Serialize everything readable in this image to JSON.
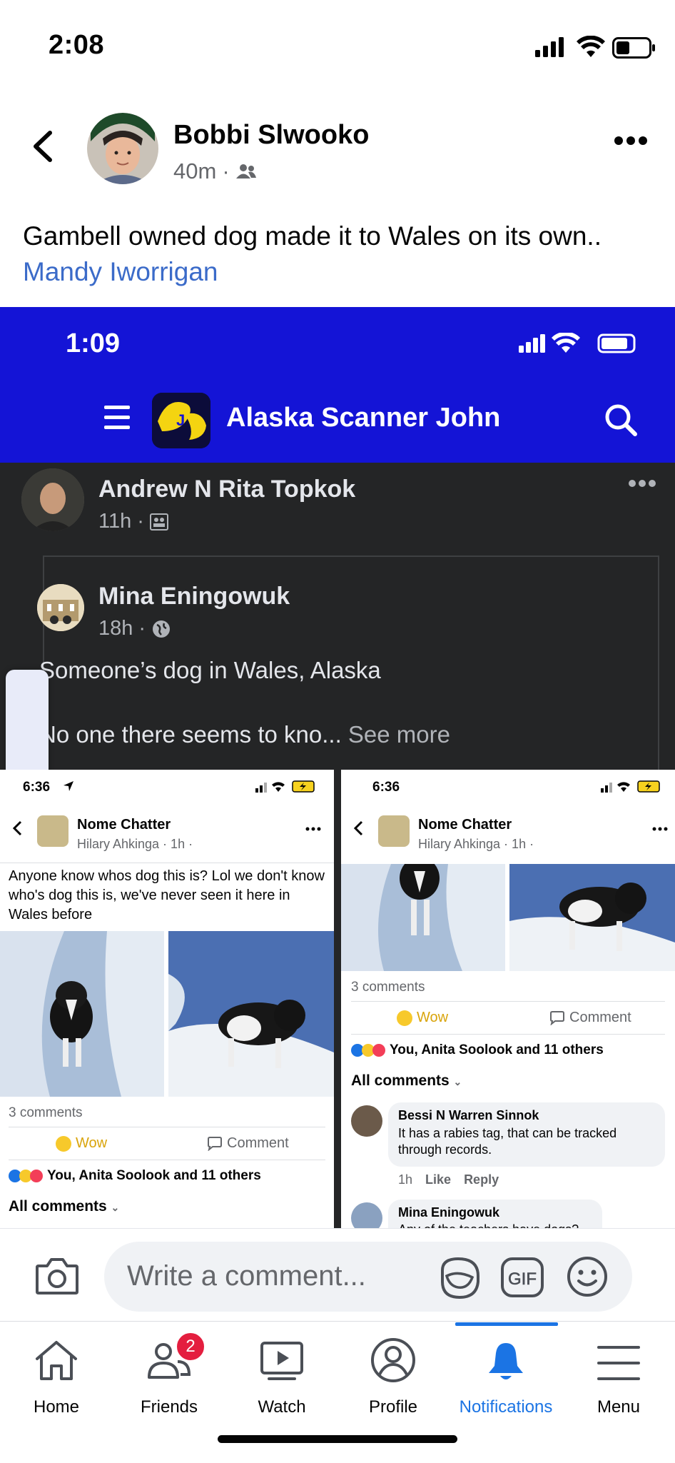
{
  "status_bar": {
    "time": "2:08"
  },
  "header": {
    "poster_name": "Bobbi Slwooko",
    "time_ago": "40m",
    "separator": "·"
  },
  "caption": {
    "text": "Gambell owned dog made it to Wales on its own..",
    "tagged_name": "Mandy Iworrigan"
  },
  "embedded": {
    "status_time": "1:09",
    "group_title": "Alaska Scanner John",
    "sharer": {
      "name": "Andrew N Rita Topkok",
      "time": "11h",
      "sep": "·"
    },
    "original": {
      "name": "Mina Eningowuk",
      "time": "18h",
      "sep": "·",
      "line1": "Someone’s dog in Wales, Alaska",
      "line2": "No one there seems to kno...",
      "see_more": "See more"
    },
    "left_panel": {
      "time": "6:36",
      "group": "Nome Chatter",
      "author_meta": "Hilary Ahkinga · 1h ·",
      "post_text": "Anyone know whos dog this is? Lol we don't know who's dog this is, we've never seen it here in Wales before",
      "comments_count": "3 comments",
      "wow": "Wow",
      "comment": "Comment",
      "reactions": "You, Anita Soolook and 11 others",
      "all_comments": "All comments"
    },
    "right_panel": {
      "time": "6:36",
      "group": "Nome Chatter",
      "author_meta": "Hilary Ahkinga · 1h ·",
      "comments_count": "3 comments",
      "wow": "Wow",
      "comment": "Comment",
      "reactions": "You, Anita Soolook and 11 others",
      "all_comments": "All comments",
      "c1_name": "Bessi N Warren Sinnok",
      "c1_text": "It has a rabies tag, that can be tracked through records.",
      "c1_time": "1h",
      "c1_like": "Like",
      "c1_reply": "Reply",
      "c2_name": "Mina Eningowuk",
      "c2_text": "Any of the teachers have dogs?"
    }
  },
  "composer": {
    "placeholder": "Write a comment..."
  },
  "nav": {
    "items": [
      {
        "label": "Home",
        "icon": "home-icon"
      },
      {
        "label": "Friends",
        "icon": "friends-icon",
        "badge": "2"
      },
      {
        "label": "Watch",
        "icon": "watch-icon"
      },
      {
        "label": "Profile",
        "icon": "profile-icon"
      },
      {
        "label": "Notifications",
        "icon": "bell-icon",
        "active": true
      },
      {
        "label": "Menu",
        "icon": "menu-icon"
      }
    ]
  },
  "colors": {
    "accent": "#1b74e4",
    "link": "#3b6bc9",
    "banner": "#1414d6",
    "badge": "#e41e3f"
  }
}
